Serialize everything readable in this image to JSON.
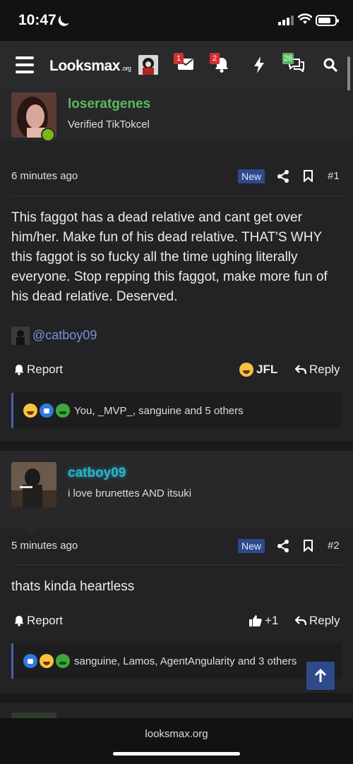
{
  "status_bar": {
    "time": "10:47"
  },
  "nav": {
    "logo": "Looksmax",
    "logo_suffix": ".org",
    "badges": {
      "inbox": "1",
      "alerts": "2",
      "messages": "26"
    }
  },
  "posts": [
    {
      "username": "loseratgenes",
      "username_color": "#5cb85c",
      "user_title": "Verified TikTokcel",
      "time": "6 minutes ago",
      "new_label": "New",
      "number": "#1",
      "body": "This faggot has a dead relative and cant get over him/her. Make fun of his dead relative. THAT'S WHY this faggot is so fucky all the time ughing literally everyone. Stop repping this faggot, make more fun of his dead relative. Deserved.",
      "mention": "@catboy09",
      "actions": {
        "report": "Report",
        "reaction": "JFL",
        "reply": "Reply"
      },
      "reactions_text": "You, _MVP_, sanguine and 5 others"
    },
    {
      "username": "catboy09",
      "username_color": "#2fb4c9",
      "user_title": "i love brunettes AND itsuki",
      "time": "5 minutes ago",
      "new_label": "New",
      "number": "#2",
      "body": "thats kinda heartless",
      "actions": {
        "report": "Report",
        "reaction": "+1",
        "reply": "Reply"
      },
      "reactions_text": "sanguine, Lamos, AgentAngularity and 3 others"
    }
  ],
  "browser": {
    "url": "looksmax.org"
  }
}
